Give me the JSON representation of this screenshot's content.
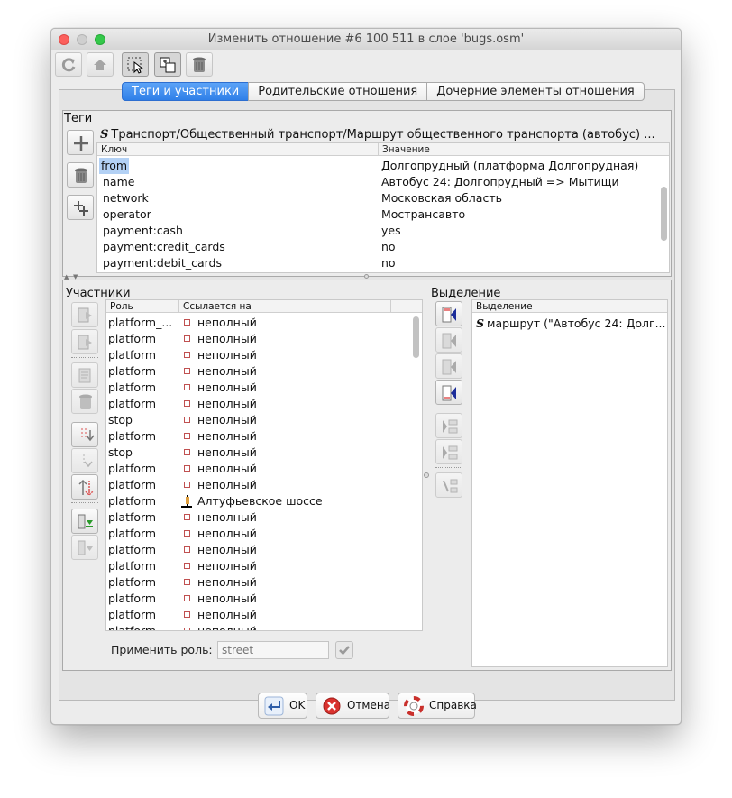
{
  "window": {
    "title": "Изменить отношение #6 100 511 в слое 'bugs.osm'"
  },
  "toolbar": {
    "buttons": [
      "refresh-icon",
      "upload-icon",
      "select-icon",
      "zoom-to-icon",
      "delete-icon"
    ]
  },
  "tabs": [
    {
      "label": "Теги и участники",
      "active": true
    },
    {
      "label": "Родительские отношения",
      "active": false
    },
    {
      "label": "Дочерние элементы отношения",
      "active": false
    }
  ],
  "tags": {
    "section_label": "Теги",
    "preset_icon": "S",
    "preset_path": "Транспорт/Общественный транспорт/Маршрут общественного транспорта (автобус) ...",
    "columns": {
      "key": "Ключ",
      "value": "Значение"
    },
    "rows": [
      {
        "key": "from",
        "value": "Долгопрудный (платформа Долгопрудная)",
        "selected": true
      },
      {
        "key": "name",
        "value": "Автобус 24: Долгопрудный => Мытищи",
        "selected": false
      },
      {
        "key": "network",
        "value": "Московская область",
        "selected": false
      },
      {
        "key": "operator",
        "value": "Мострансавто",
        "selected": false
      },
      {
        "key": "payment:cash",
        "value": "yes",
        "selected": false
      },
      {
        "key": "payment:credit_cards",
        "value": "no",
        "selected": false
      },
      {
        "key": "payment:debit_cards",
        "value": "no",
        "selected": false
      }
    ]
  },
  "members": {
    "section_label": "Участники",
    "columns": {
      "role": "Роль",
      "refers": "Ссылается на"
    },
    "rows": [
      {
        "role": "platform_...",
        "ref": "неполный",
        "type": "node"
      },
      {
        "role": "platform",
        "ref": "неполный",
        "type": "node"
      },
      {
        "role": "platform",
        "ref": "неполный",
        "type": "node"
      },
      {
        "role": "platform",
        "ref": "неполный",
        "type": "node"
      },
      {
        "role": "platform",
        "ref": "неполный",
        "type": "node"
      },
      {
        "role": "platform",
        "ref": "неполный",
        "type": "node"
      },
      {
        "role": "stop",
        "ref": "неполный",
        "type": "node"
      },
      {
        "role": "platform",
        "ref": "неполный",
        "type": "node"
      },
      {
        "role": "stop",
        "ref": "неполный",
        "type": "node"
      },
      {
        "role": "platform",
        "ref": "неполный",
        "type": "node"
      },
      {
        "role": "platform",
        "ref": "неполный",
        "type": "node"
      },
      {
        "role": "platform",
        "ref": "Алтуфьевское шоссе",
        "type": "way"
      },
      {
        "role": "platform",
        "ref": "неполный",
        "type": "node"
      },
      {
        "role": "platform",
        "ref": "неполный",
        "type": "node"
      },
      {
        "role": "platform",
        "ref": "неполный",
        "type": "node"
      },
      {
        "role": "platform",
        "ref": "неполный",
        "type": "node"
      },
      {
        "role": "platform",
        "ref": "неполный",
        "type": "node"
      },
      {
        "role": "platform",
        "ref": "неполный",
        "type": "node"
      },
      {
        "role": "platform",
        "ref": "неполный",
        "type": "node"
      },
      {
        "role": "platform",
        "ref": "неполный",
        "type": "node"
      }
    ],
    "apply_role_label": "Применить роль:",
    "apply_role_placeholder": "street"
  },
  "selection": {
    "section_label": "Выделение",
    "column": "Выделение",
    "icon": "S",
    "item": "маршрут (\"Автобус 24: Долг..."
  },
  "buttons": {
    "ok": "OK",
    "cancel": "Отмена",
    "help": "Справка"
  }
}
